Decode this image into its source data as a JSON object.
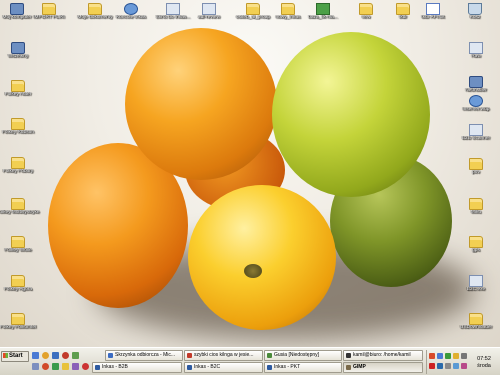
{
  "desktop": {
    "top_row": [
      {
        "label": "Mój komputer",
        "icon": "computer-icon"
      },
      {
        "label": "IMPORT PLIKI",
        "icon": "folder-icon"
      },
      {
        "label": "Moje dokumenty",
        "icon": "documents-icon"
      },
      {
        "label": "Koncole Inkas",
        "icon": "app-icon"
      },
      {
        "label": "Skrót do Inkas...",
        "icon": "shortcut-icon"
      },
      {
        "label": "adf-review",
        "icon": "shortcut-icon"
      },
      {
        "label": "ositeb_al_proap",
        "icon": "folder-icon"
      },
      {
        "label": "nowy_inkas",
        "icon": "folder-icon"
      },
      {
        "label": "baza_lik-nia...",
        "icon": "spreadsheet-icon"
      },
      {
        "label": "new",
        "icon": "folder-icon"
      },
      {
        "label": "tkdr",
        "icon": "folder-icon"
      },
      {
        "label": "tkdr API.txt",
        "icon": "text-file-icon"
      },
      {
        "label": "Kosz",
        "icon": "recycle-bin-icon"
      }
    ],
    "left_column": [
      {
        "label": "Wszelkny",
        "icon": "network-icon"
      },
      {
        "label": "Folkey Auter",
        "icon": "folder-icon"
      },
      {
        "label": "Folkey Rubson",
        "icon": "folder-icon"
      },
      {
        "label": "Folkey Fobory",
        "icon": "folder-icon"
      },
      {
        "label": "Folkey Multisystryke",
        "icon": "folder-icon"
      },
      {
        "label": "Folkey Wolle",
        "icon": "folder-icon"
      },
      {
        "label": "Folkey Agora",
        "icon": "folder-icon"
      },
      {
        "label": "Folkey Folkomtel",
        "icon": "folder-icon"
      }
    ],
    "right_column": [
      {
        "label": "Raw",
        "icon": "shortcut-icon"
      },
      {
        "label": "NetInstlier",
        "icon": "network-icon"
      },
      {
        "label": "inserver.wdp",
        "icon": "globe-icon"
      },
      {
        "label": "B2B Scanner",
        "icon": "scanner-icon"
      },
      {
        "label": "pov",
        "icon": "folder-icon"
      },
      {
        "label": "Miku",
        "icon": "folder-icon"
      },
      {
        "label": "gps",
        "icon": "folder-icon"
      },
      {
        "label": "B2C.exe",
        "icon": "exe-icon"
      },
      {
        "label": "USDownloader",
        "icon": "folder-icon"
      }
    ]
  },
  "taskbar": {
    "start_label": "Start",
    "tasks_row1": [
      {
        "label": "Skrzynka odbiorcza - Mic...",
        "color": "#3a6bc2"
      },
      {
        "label": "szybki cios kilnga w jesie...",
        "color": "#c23a2a"
      },
      {
        "label": "Gusia [Niedostępny]",
        "color": "#4a8a3a"
      },
      {
        "label": "kamil@biuro: /home/kamil",
        "color": "#333333"
      }
    ],
    "tasks_row2": [
      {
        "label": "Inkas - B2B",
        "color": "#2d5aa0"
      },
      {
        "label": "Inkas - B2C",
        "color": "#2d5aa0"
      },
      {
        "label": "Inkas - PKT",
        "color": "#2d5aa0"
      },
      {
        "label": "GIMP",
        "color": "#7a6a4a",
        "active": true
      }
    ],
    "clock": {
      "time": "07:52",
      "day": "środa"
    }
  }
}
